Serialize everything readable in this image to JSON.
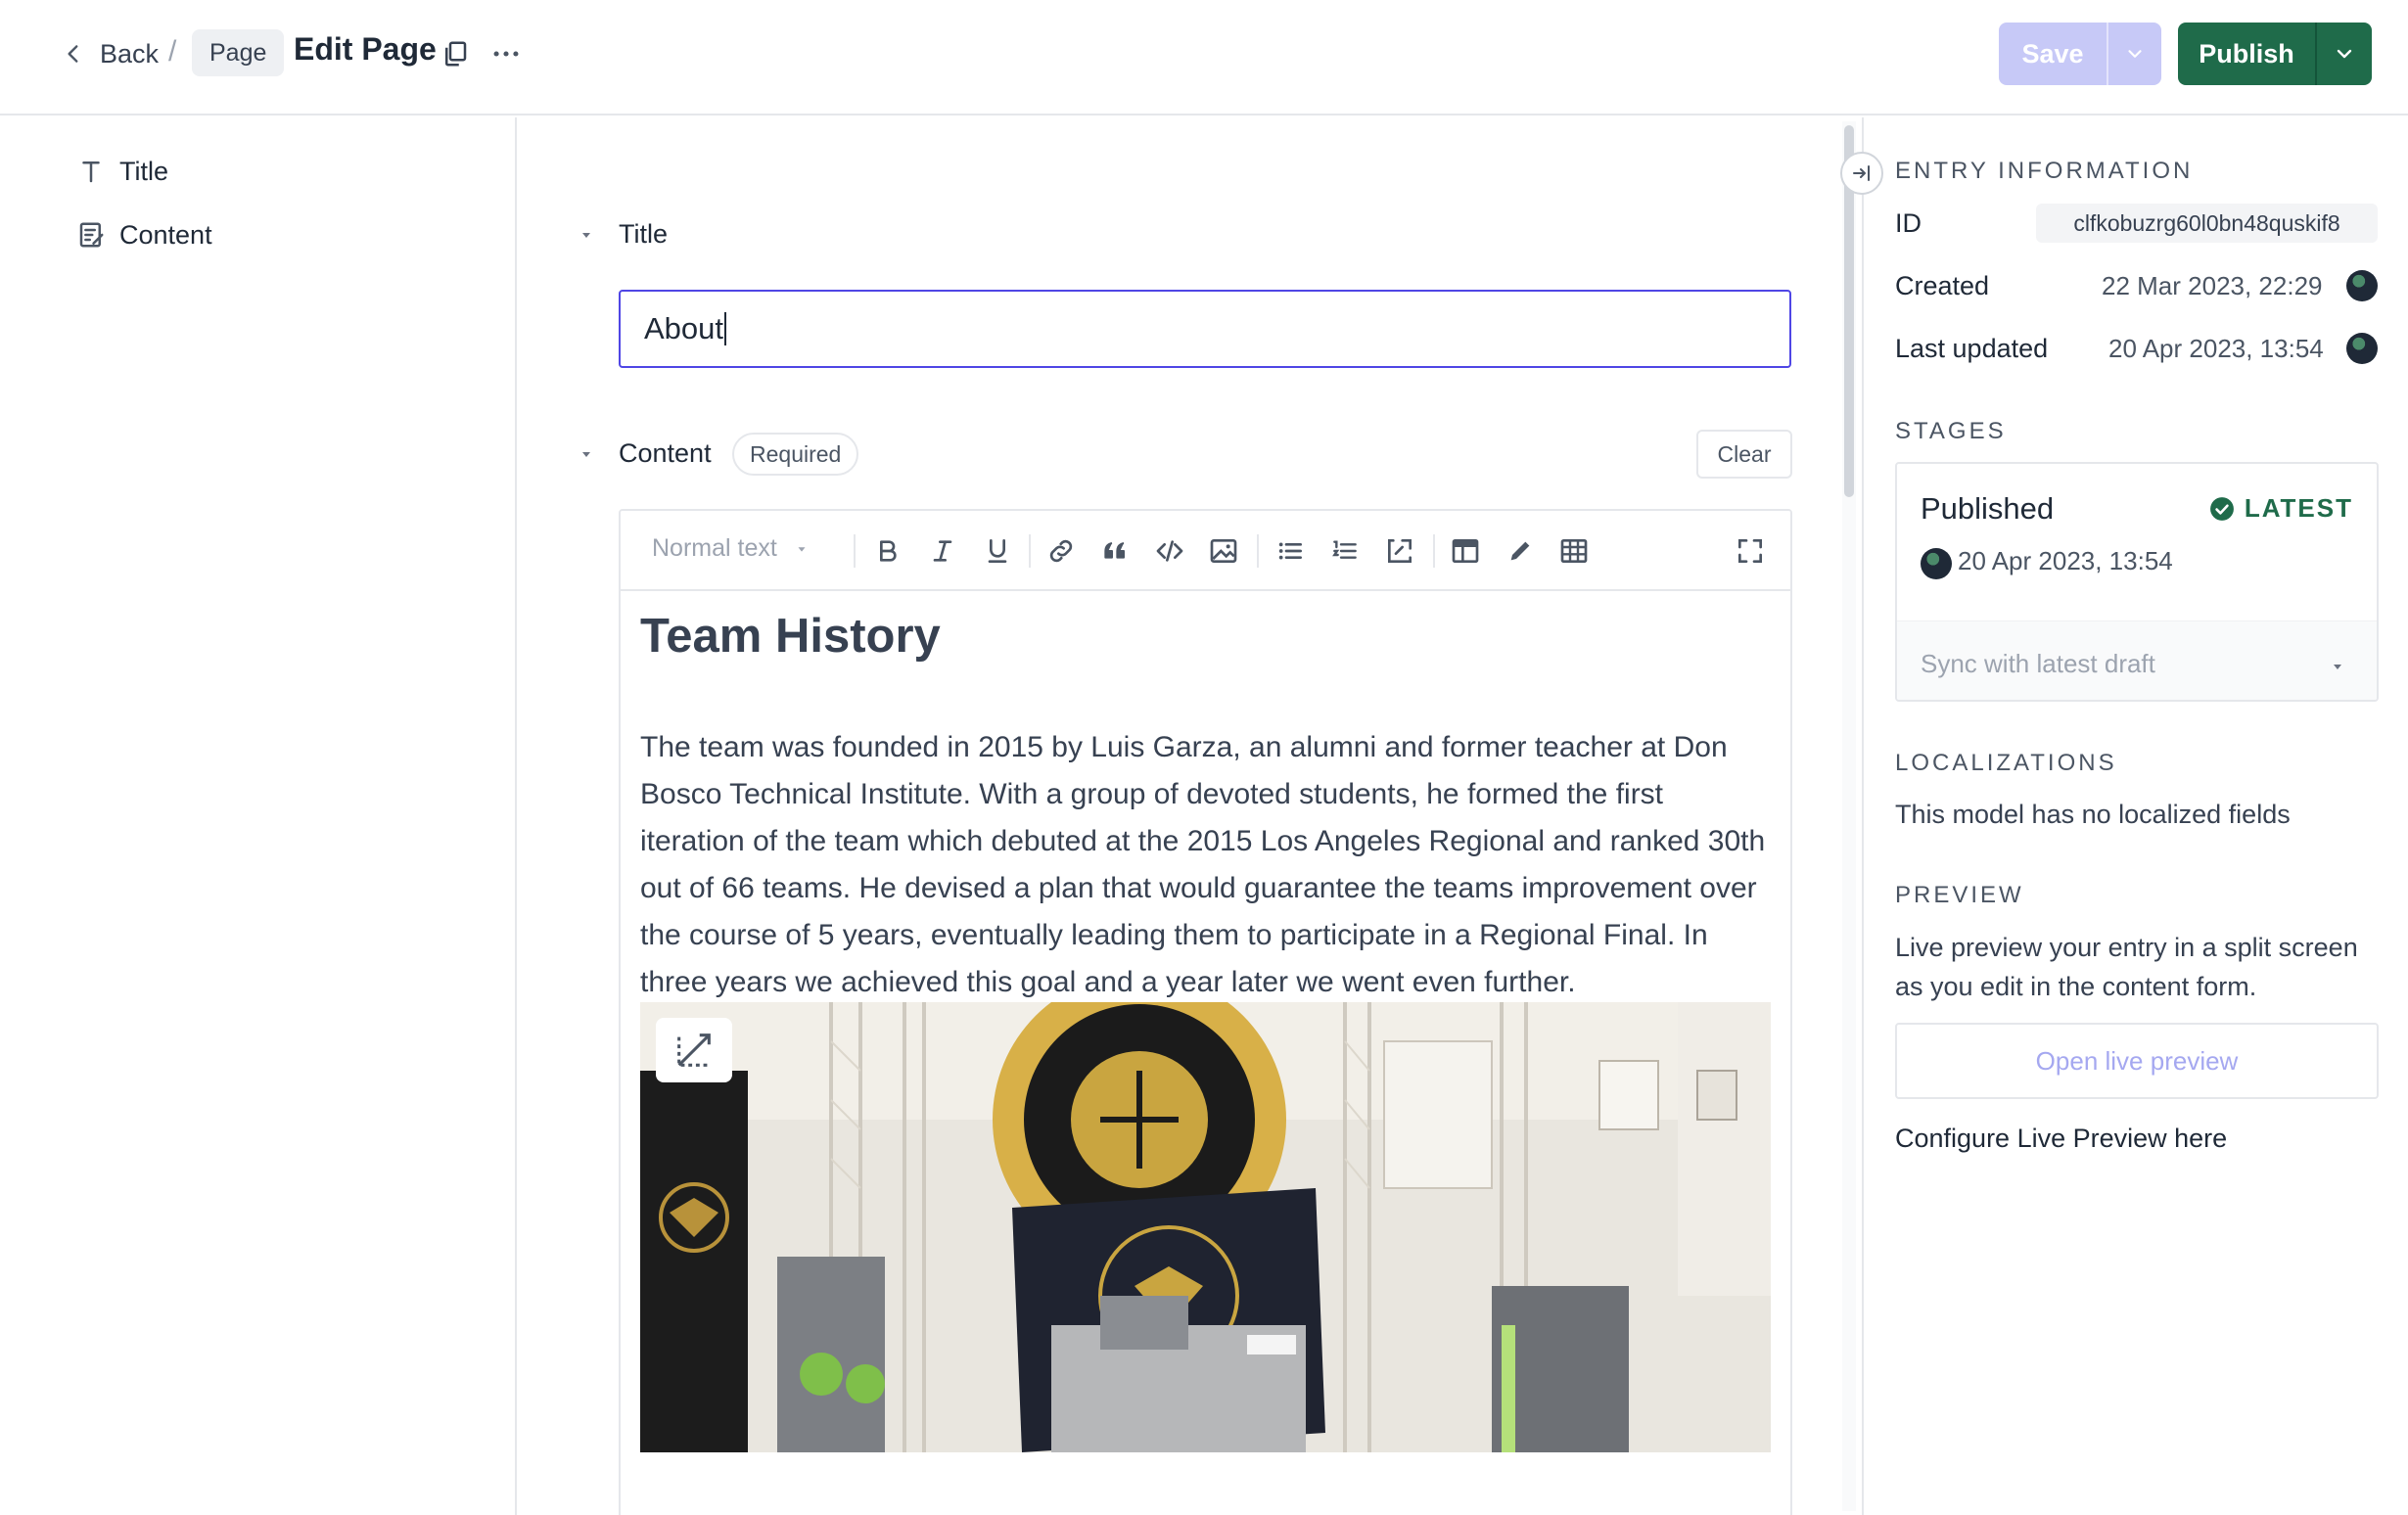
{
  "header": {
    "back_label": "Back",
    "separator": "/",
    "breadcrumb_chip": "Page",
    "page_title": "Edit Page",
    "save_label": "Save",
    "publish_label": "Publish",
    "colors": {
      "publish": "#1f6b4a",
      "save_disabled": "#c7c9f7"
    }
  },
  "sidebar": {
    "items": [
      {
        "label": "Title",
        "icon": "text-type-icon"
      },
      {
        "label": "Content",
        "icon": "rich-text-icon"
      }
    ]
  },
  "main": {
    "title_field": {
      "label": "Title",
      "value": "About"
    },
    "content_field": {
      "label": "Content",
      "required_badge": "Required",
      "clear_label": "Clear",
      "block_style": "Normal text",
      "heading": "Team History",
      "paragraph": "The team was founded in 2015 by Luis Garza, an alumni and former teacher at Don Bosco Technical Institute. With a group of devoted students, he formed the first iteration of the team which debuted at the 2015 Los Angeles Regional and ranked 30th out of 66 teams. He devised a plan that would guarantee the teams improvement over the course of 5 years, eventually leading them to participate in a Regional Final. In three years we achieved this goal and a year later we went even further."
    },
    "toolbar_icons": [
      "bold-icon",
      "italic-icon",
      "underline-icon",
      "link-icon",
      "quote-icon",
      "code-icon",
      "image-icon",
      "bulleted-list-icon",
      "numbered-list-icon",
      "code-block-icon",
      "embed-icon",
      "pen-icon",
      "table-icon",
      "fullscreen-icon"
    ]
  },
  "entry_info": {
    "section_title": "ENTRY INFORMATION",
    "id_label": "ID",
    "id_value": "clfkobuzrg60l0bn48quskif8",
    "created_label": "Created",
    "created_value": "22 Mar 2023, 22:29",
    "updated_label": "Last updated",
    "updated_value": "20 Apr 2023, 13:54"
  },
  "stages": {
    "section_title": "STAGES",
    "stage_name": "Published",
    "badge": "LATEST",
    "date": "20 Apr 2023, 13:54",
    "sync_label": "Sync with latest draft"
  },
  "localizations": {
    "section_title": "LOCALIZATIONS",
    "text": "This model has no localized fields"
  },
  "preview": {
    "section_title": "PREVIEW",
    "description": "Live preview your entry in a split screen as you edit in the content form.",
    "open_label": "Open live preview",
    "configure_label": "Configure Live Preview here"
  }
}
